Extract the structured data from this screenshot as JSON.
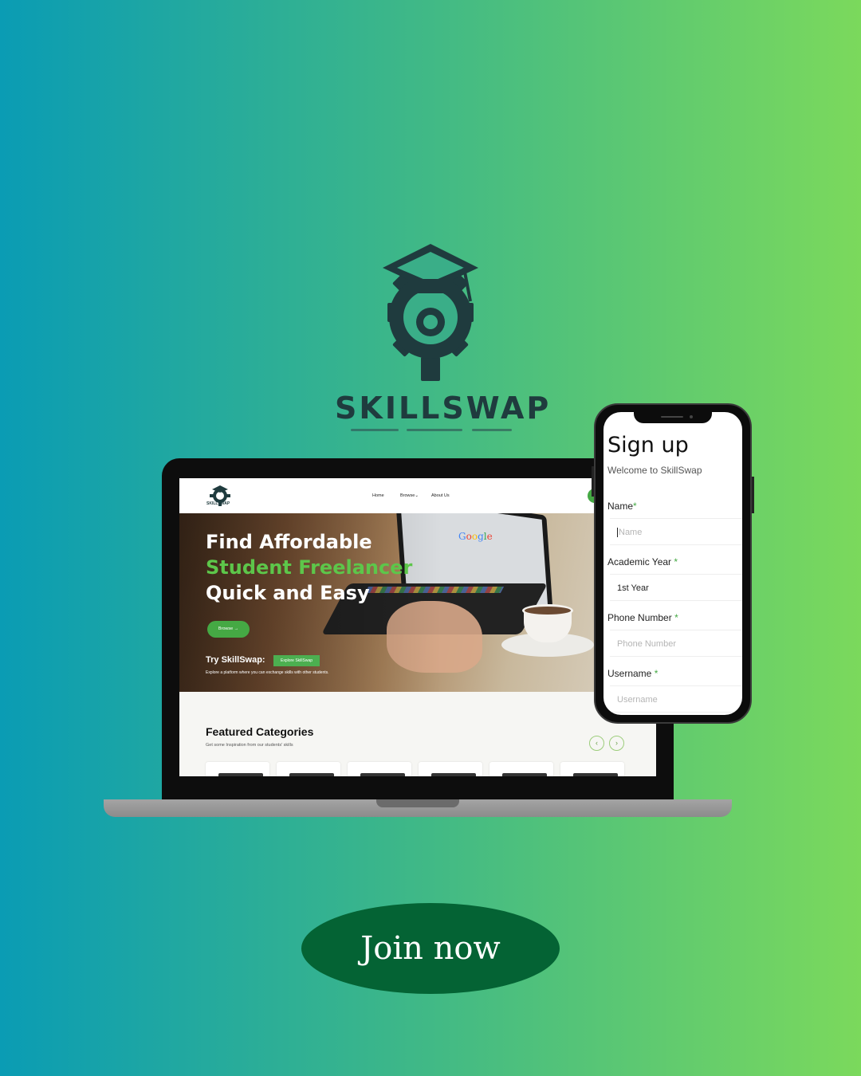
{
  "brand": {
    "name": "SKILLSWAP",
    "logo_icon": "gear-graduation-cap-icon"
  },
  "colors": {
    "bg_start": "#0a9cb4",
    "bg_end": "#7bd95c",
    "accent_green": "#45a944",
    "cta": "#046334"
  },
  "website": {
    "logo_text": "SKILLSWAP",
    "nav": {
      "home": "Home",
      "browse": "Browse",
      "about": "About Us"
    },
    "hero": {
      "line1": "Find Affordable",
      "line2": "Student Freelancer",
      "line3": "Quick and Easy",
      "browse_button": "Browse",
      "try_label": "Try SkillSwap:",
      "explore_badge": "Explore SkillSwap",
      "explore_desc": "Explore a platform where you can exchange skills with other students."
    },
    "featured": {
      "title": "Featured Categories",
      "subtitle": "Get some Inspiration from our students' skills"
    }
  },
  "signup": {
    "title": "Sign up",
    "subtitle": "Welcome to SkillSwap",
    "fields": [
      {
        "label": "Name",
        "placeholder": "Name",
        "value": ""
      },
      {
        "label": "Academic Year",
        "placeholder": "",
        "value": "1st Year"
      },
      {
        "label": "Phone Number",
        "placeholder": "Phone Number",
        "value": ""
      },
      {
        "label": "Username",
        "placeholder": "Username",
        "value": ""
      }
    ]
  },
  "cta": {
    "label": "Join now"
  }
}
